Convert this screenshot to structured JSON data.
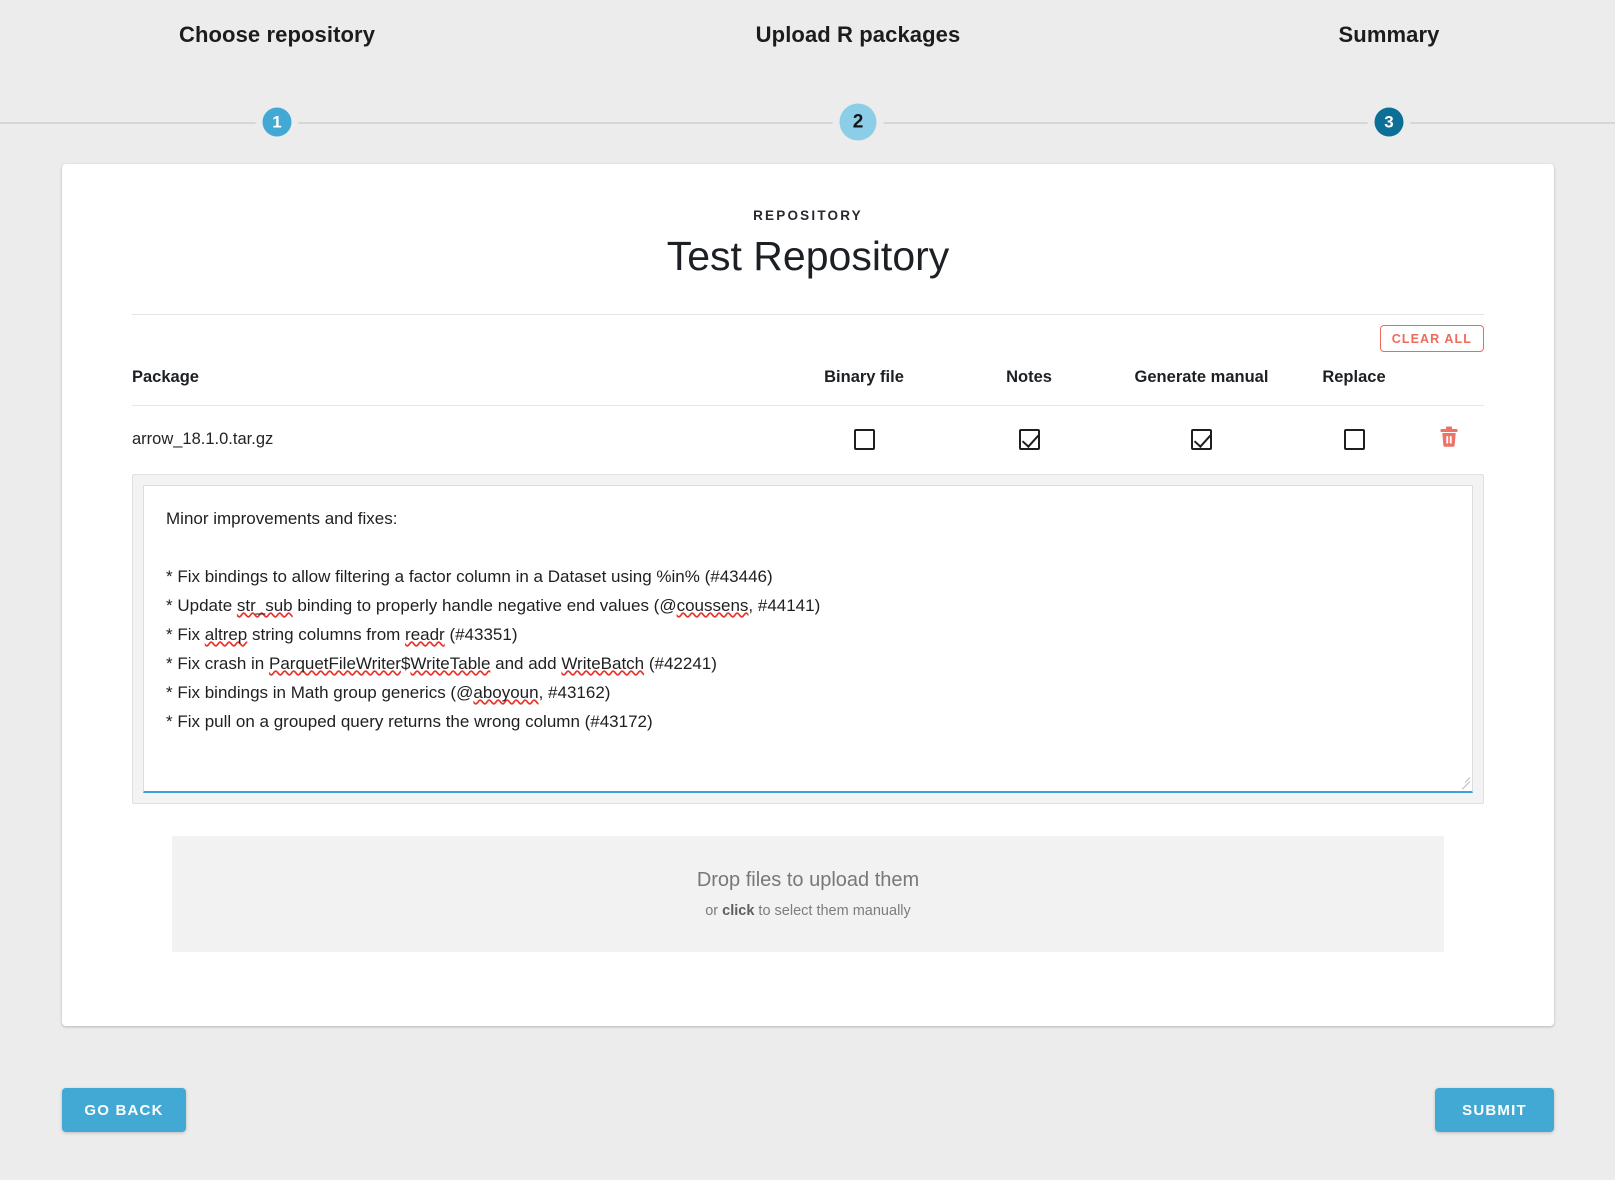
{
  "stepper": {
    "steps": [
      {
        "number": "1",
        "label": "Choose repository",
        "state": "complete",
        "color": "#41a9d4"
      },
      {
        "number": "2",
        "label": "Upload R packages",
        "state": "active",
        "color": "#8ccde8"
      },
      {
        "number": "3",
        "label": "Summary",
        "state": "upcoming",
        "color": "#0b6f96"
      }
    ]
  },
  "card": {
    "kicker": "REPOSITORY",
    "title": "Test Repository",
    "clear_all_label": "CLEAR ALL",
    "clear_all_color": "#ef6a5c",
    "table": {
      "headers": [
        "Package",
        "Binary file",
        "Notes",
        "Generate manual",
        "Replace"
      ],
      "rows": [
        {
          "package": "arrow_18.1.0.tar.gz",
          "binary_file": false,
          "notes": true,
          "generate_manual": true,
          "replace": false,
          "delete_icon": "trash-icon",
          "delete_color": "#ef6a5c"
        }
      ]
    },
    "notes_editor": {
      "value_lines": [
        "Minor improvements and fixes:",
        "",
        "* Fix bindings to allow filtering a factor column in a Dataset using %in% (#43446)",
        "* Update str_sub binding to properly handle negative end values (@coussens, #44141)",
        "* Fix altrep string columns from readr (#43351)",
        "* Fix crash in ParquetFileWriter$WriteTable and add WriteBatch (#42241)",
        "* Fix bindings in Math group generics (@aboyoun, #43162)",
        "* Fix pull on a grouped query returns the wrong column (#43172)"
      ],
      "misspelled_words": [
        "str_sub",
        "coussens",
        "altrep",
        "readr",
        "ParquetFileWriter",
        "WriteTable",
        "WriteBatch",
        "aboyoun"
      ],
      "focus_underline_color": "#3aa3da"
    },
    "dropzone": {
      "main_text": "Drop files to upload them",
      "sub_prefix": "or ",
      "sub_emphasis": "click",
      "sub_suffix": " to select them manually"
    }
  },
  "footer": {
    "back_label": "GO BACK",
    "submit_label": "SUBMIT",
    "button_color": "#41a9d4"
  }
}
